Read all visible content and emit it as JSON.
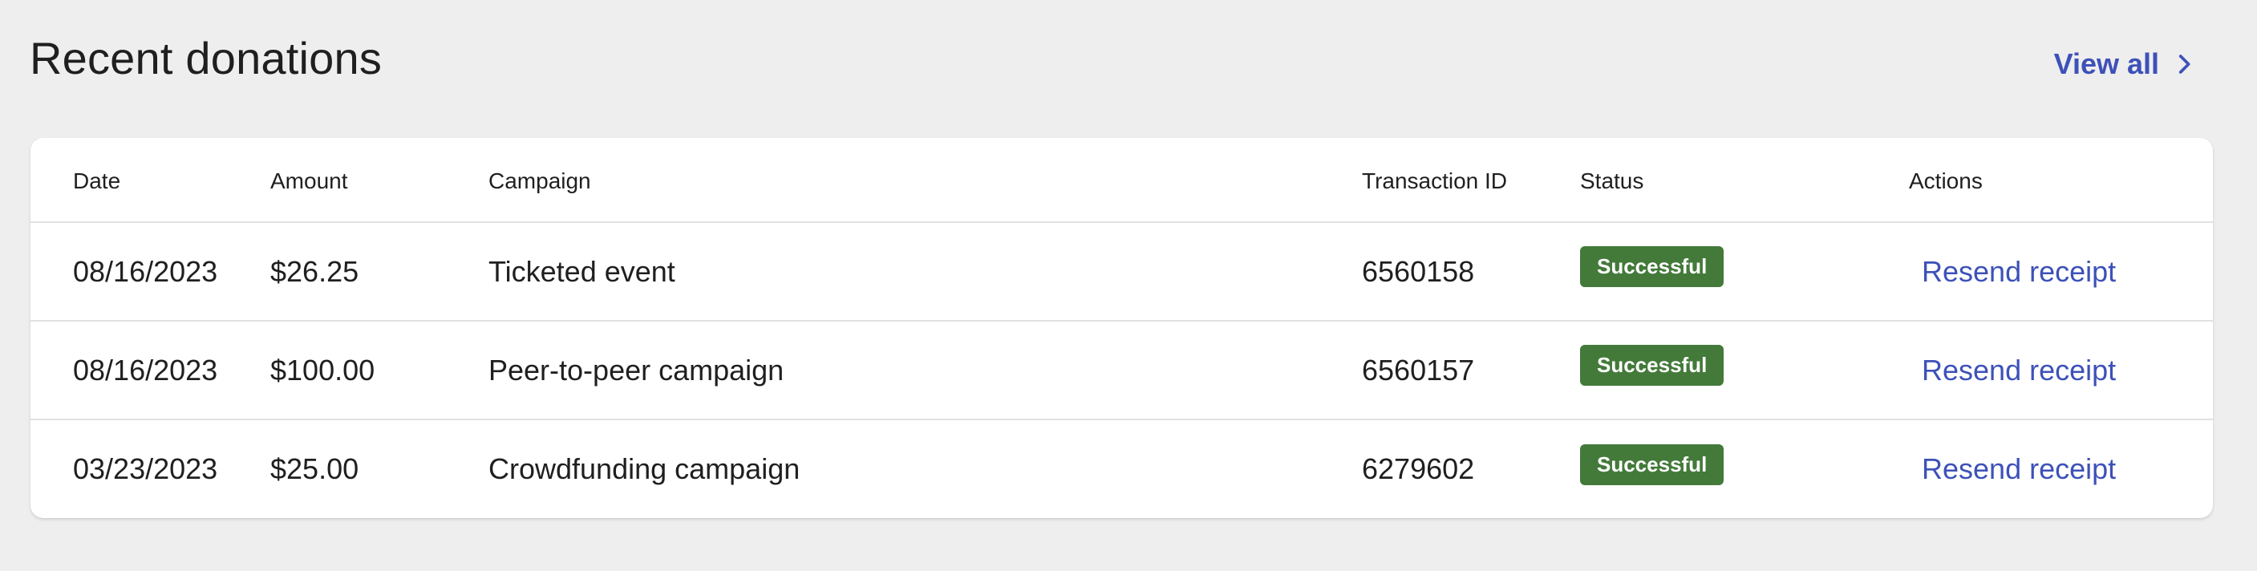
{
  "header": {
    "title": "Recent donations",
    "view_all_label": "View all"
  },
  "table": {
    "columns": [
      "Date",
      "Amount",
      "Campaign",
      "Transaction ID",
      "Status",
      "Actions"
    ],
    "rows": [
      {
        "date": "08/16/2023",
        "amount": "$26.25",
        "campaign": "Ticketed event",
        "transaction_id": "6560158",
        "status": "Successful",
        "action": "Resend receipt"
      },
      {
        "date": "08/16/2023",
        "amount": "$100.00",
        "campaign": "Peer-to-peer campaign",
        "transaction_id": "6560157",
        "status": "Successful",
        "action": "Resend receipt"
      },
      {
        "date": "03/23/2023",
        "amount": "$25.00",
        "campaign": "Crowdfunding campaign",
        "transaction_id": "6279602",
        "status": "Successful",
        "action": "Resend receipt"
      }
    ]
  },
  "colors": {
    "link": "#3d51b8",
    "success_badge": "#437a3a",
    "background": "#eeeeee"
  },
  "icons": {
    "view_all_arrow": "chevron-right-icon"
  }
}
